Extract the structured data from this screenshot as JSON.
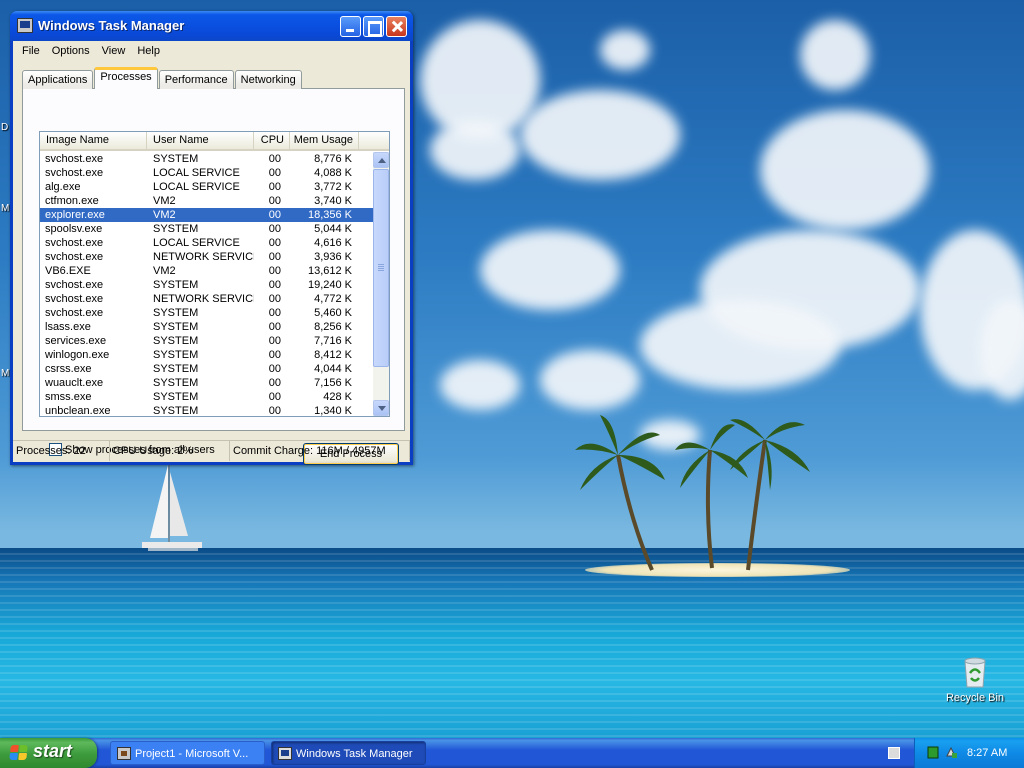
{
  "desktop": {
    "edge_letters": [
      "D",
      "M",
      "M"
    ],
    "icons": [
      {
        "label": "Recycle Bin"
      }
    ]
  },
  "window": {
    "title": "Windows Task Manager",
    "menu": [
      "File",
      "Options",
      "View",
      "Help"
    ],
    "tabs": [
      {
        "label": "Applications",
        "active": false
      },
      {
        "label": "Processes",
        "active": true
      },
      {
        "label": "Performance",
        "active": false
      },
      {
        "label": "Networking",
        "active": false
      }
    ],
    "columns": [
      "Image Name",
      "User Name",
      "CPU",
      "Mem Usage"
    ],
    "processes": [
      {
        "name": "svchost.exe",
        "user": "SYSTEM",
        "cpu": "00",
        "mem": "8,776 K"
      },
      {
        "name": "svchost.exe",
        "user": "LOCAL SERVICE",
        "cpu": "00",
        "mem": "4,088 K"
      },
      {
        "name": "alg.exe",
        "user": "LOCAL SERVICE",
        "cpu": "00",
        "mem": "3,772 K"
      },
      {
        "name": "ctfmon.exe",
        "user": "VM2",
        "cpu": "00",
        "mem": "3,740 K"
      },
      {
        "name": "explorer.exe",
        "user": "VM2",
        "cpu": "00",
        "mem": "18,356 K",
        "selected": true
      },
      {
        "name": "spoolsv.exe",
        "user": "SYSTEM",
        "cpu": "00",
        "mem": "5,044 K"
      },
      {
        "name": "svchost.exe",
        "user": "LOCAL SERVICE",
        "cpu": "00",
        "mem": "4,616 K"
      },
      {
        "name": "svchost.exe",
        "user": "NETWORK SERVICE",
        "cpu": "00",
        "mem": "3,936 K"
      },
      {
        "name": "VB6.EXE",
        "user": "VM2",
        "cpu": "00",
        "mem": "13,612 K"
      },
      {
        "name": "svchost.exe",
        "user": "SYSTEM",
        "cpu": "00",
        "mem": "19,240 K"
      },
      {
        "name": "svchost.exe",
        "user": "NETWORK SERVICE",
        "cpu": "00",
        "mem": "4,772 K"
      },
      {
        "name": "svchost.exe",
        "user": "SYSTEM",
        "cpu": "00",
        "mem": "5,460 K"
      },
      {
        "name": "lsass.exe",
        "user": "SYSTEM",
        "cpu": "00",
        "mem": "8,256 K"
      },
      {
        "name": "services.exe",
        "user": "SYSTEM",
        "cpu": "00",
        "mem": "7,716 K"
      },
      {
        "name": "winlogon.exe",
        "user": "SYSTEM",
        "cpu": "00",
        "mem": "8,412 K"
      },
      {
        "name": "csrss.exe",
        "user": "SYSTEM",
        "cpu": "00",
        "mem": "4,044 K"
      },
      {
        "name": "wuauclt.exe",
        "user": "SYSTEM",
        "cpu": "00",
        "mem": "7,156 K"
      },
      {
        "name": "smss.exe",
        "user": "SYSTEM",
        "cpu": "00",
        "mem": "428 K"
      },
      {
        "name": "unbclean.exe",
        "user": "SYSTEM",
        "cpu": "00",
        "mem": "1,340 K"
      }
    ],
    "show_all_label": "Show processes from all users",
    "show_all_checked": false,
    "end_process_label": "End Process",
    "status": {
      "processes": "Processes: 22",
      "cpu": "CPU Usage: 2%",
      "commit": "Commit Charge: 116M / 4957M"
    }
  },
  "taskbar": {
    "start_label": "start",
    "tasks": [
      {
        "label": "Project1 - Microsoft V...",
        "active": false
      },
      {
        "label": "Windows Task Manager",
        "active": true
      }
    ],
    "clock": "8:27 AM"
  },
  "colors": {
    "selection": "#316ac5",
    "titlebar": "#0a4fe0",
    "taskbar": "#2157d7",
    "start": "#3d9a3c",
    "tray": "#0e8ae6"
  }
}
